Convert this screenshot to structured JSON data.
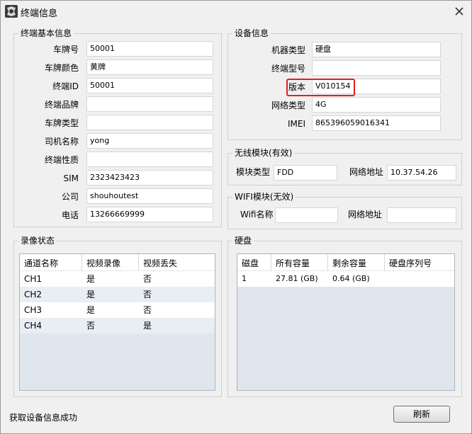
{
  "window": {
    "title": "终端信息",
    "icon": "app-logo-icon",
    "close_icon": "close-icon"
  },
  "basic": {
    "title": "终端基本信息",
    "fields": [
      {
        "label": "车牌号",
        "value": "50001"
      },
      {
        "label": "车牌颜色",
        "value": "黄牌"
      },
      {
        "label": "终端ID",
        "value": "50001"
      },
      {
        "label": "终端品牌",
        "value": ""
      },
      {
        "label": "车牌类型",
        "value": ""
      },
      {
        "label": "司机名称",
        "value": "yong"
      },
      {
        "label": "终端性质",
        "value": ""
      },
      {
        "label": "SIM",
        "value": "2323423423"
      },
      {
        "label": "公司",
        "value": "shouhoutest"
      },
      {
        "label": "电话",
        "value": "13266669999"
      }
    ]
  },
  "device": {
    "title": "设备信息",
    "fields": [
      {
        "label": "机器类型",
        "value": "硬盘"
      },
      {
        "label": "终端型号",
        "value": ""
      },
      {
        "label": "版本",
        "value": "V010154"
      },
      {
        "label": "网络类型",
        "value": "4G"
      },
      {
        "label": "IMEI",
        "value": "865396059016341"
      }
    ],
    "highlight_color": "#e02020"
  },
  "wireless": {
    "title": "无线模块(有效)",
    "type_label": "模块类型",
    "type_value": "FDD",
    "addr_label": "网络地址",
    "addr_value": "10.37.54.26"
  },
  "wifi": {
    "title": "WIFI模块(无效)",
    "name_label": "Wifi名称",
    "name_value": "",
    "addr_label": "网络地址",
    "addr_value": ""
  },
  "recording": {
    "title": "录像状态",
    "columns": [
      "通道名称",
      "视频录像",
      "视频丢失"
    ],
    "rows": [
      [
        "CH1",
        "是",
        "否"
      ],
      [
        "CH2",
        "是",
        "否"
      ],
      [
        "CH3",
        "是",
        "否"
      ],
      [
        "CH4",
        "否",
        "是"
      ]
    ]
  },
  "disk": {
    "title": "硬盘",
    "columns": [
      "磁盘",
      "所有容量",
      "剩余容量",
      "硬盘序列号"
    ],
    "rows": [
      [
        "1",
        "27.81 (GB)",
        "0.64 (GB)",
        ""
      ]
    ]
  },
  "status_text": "获取设备信息成功",
  "refresh_label": "刷新"
}
